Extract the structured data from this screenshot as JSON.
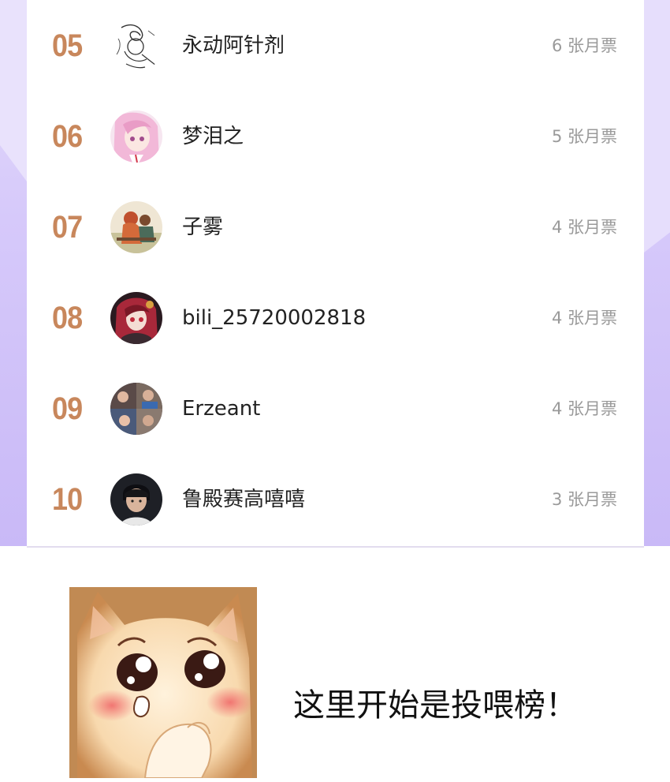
{
  "ranking": {
    "rows": [
      {
        "rank": "05",
        "name": "永动阿针剂",
        "tickets": "6 张月票"
      },
      {
        "rank": "06",
        "name": "梦泪之",
        "tickets": "5 张月票"
      },
      {
        "rank": "07",
        "name": "子雾",
        "tickets": "4 张月票"
      },
      {
        "rank": "08",
        "name": "bili_25720002818",
        "tickets": "4 张月票"
      },
      {
        "rank": "09",
        "name": "Erzeant",
        "tickets": "4 张月票"
      },
      {
        "rank": "10",
        "name": "鲁殿赛高嘻嘻",
        "tickets": "3 张月票"
      }
    ]
  },
  "footer": {
    "caption": "这里开始是投喂榜！"
  },
  "colors": {
    "rank": "#c8875c",
    "ticket_text": "#9a9a9a",
    "name_text": "#222222",
    "side_band": "#d6c9fa"
  }
}
